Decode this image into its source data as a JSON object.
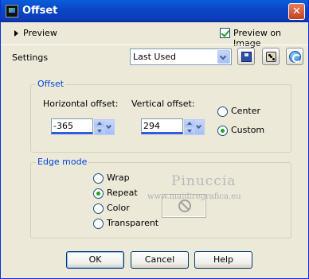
{
  "window": {
    "title": "Offset",
    "close_glyph": "✕"
  },
  "preview": {
    "toggle_label": "Preview",
    "preview_on_image_label": "Preview on Image",
    "preview_on_image_checked": true
  },
  "settings": {
    "label": "Settings",
    "preset_value": "Last Used"
  },
  "offset": {
    "group_label": "Offset",
    "horizontal_label": "Horizontal offset:",
    "horizontal_value": "-365",
    "vertical_label": "Vertical offset:",
    "vertical_value": "294",
    "center_label": "Center",
    "custom_label": "Custom",
    "selected": "Custom"
  },
  "edge_mode": {
    "group_label": "Edge mode",
    "options": [
      "Wrap",
      "Repeat",
      "Color",
      "Transparent"
    ],
    "selected": "Repeat"
  },
  "watermark": {
    "name": "Pinuccia",
    "url": "www.maidiregrafica.eu"
  },
  "buttons": {
    "ok": "OK",
    "cancel": "Cancel",
    "help": "Help"
  },
  "icons": {
    "app": "offset-app-icon",
    "save_preset": "floppy-disk-icon",
    "randomize": "dice-icon",
    "reset": "reset-icon",
    "no_color": "no-sign-icon"
  },
  "colors": {
    "titlebar": "#0a47c9",
    "dialog_bg": "#ece9d8",
    "group_label": "#0046d5",
    "radio_dot": "#21a121"
  }
}
